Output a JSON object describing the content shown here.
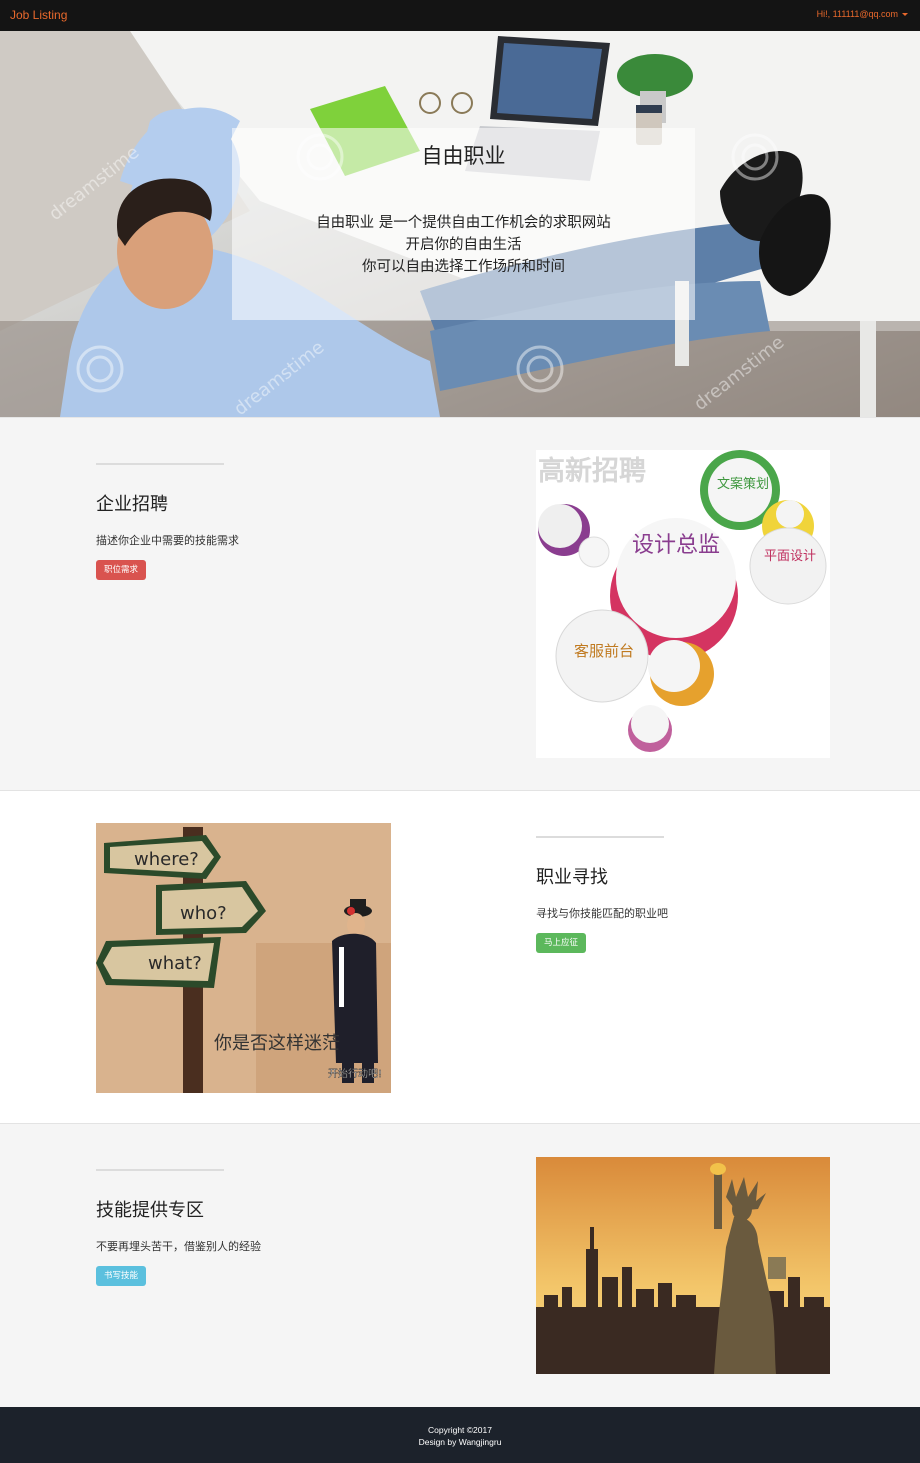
{
  "navbar": {
    "brand": "Job Listing",
    "user_greeting": "Hi!, 111111@qq.com"
  },
  "hero": {
    "title": "自由职业",
    "lines": [
      "自由职业 是一个提供自由工作机会的求职网站",
      "开启你的自由生活",
      "你可以自由选择工作场所和时间"
    ],
    "watermark": "dreamstime"
  },
  "sections": [
    {
      "title": "企业招聘",
      "description": "描述你企业中需要的技能需求",
      "button": "职位需求",
      "image": {
        "banner": "高新招聘",
        "bubbles": [
          "设计总监",
          "文案策划",
          "平面设计",
          "客服前台"
        ]
      }
    },
    {
      "title": "职业寻找",
      "description": "寻找与你技能匹配的职业吧",
      "button": "马上应征",
      "image": {
        "signs": [
          "where?",
          "who?",
          "what?"
        ],
        "caption": "你是否这样迷茫",
        "action": "开始行动吧!"
      }
    },
    {
      "title": "技能提供专区",
      "description": "不要再埋头苦干，借鉴别人的经验",
      "button": "书写技能"
    }
  ],
  "footer": {
    "copyright": "Copyright ©2017",
    "credit": "Design by Wangjingru"
  },
  "colors": {
    "brand": "#e9692c",
    "navbar": "#141414",
    "footer": "#1c222b",
    "btn_red": "#d9534f",
    "btn_green": "#5cb85c",
    "btn_blue": "#5bc0de"
  }
}
